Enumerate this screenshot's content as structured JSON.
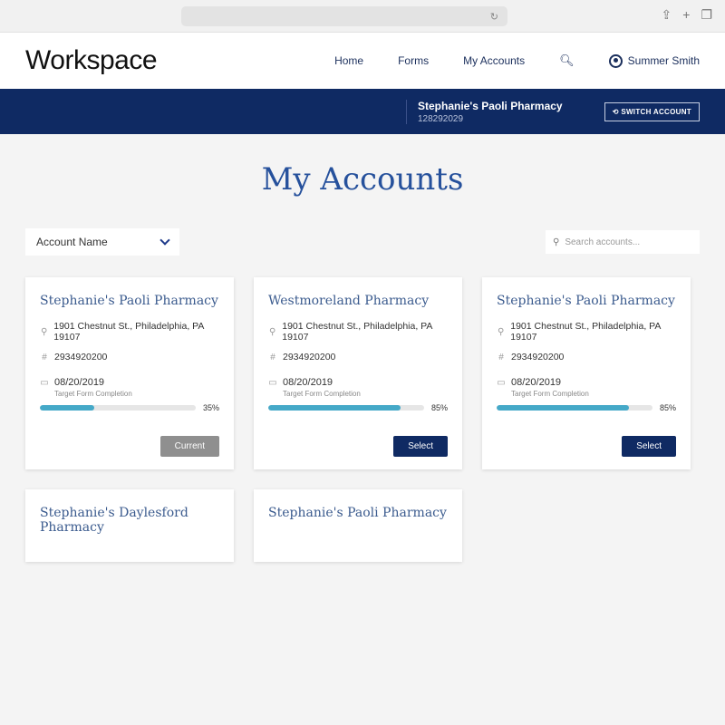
{
  "browser": {
    "url_reload_icon": "reload-icon",
    "actions": [
      "share-icon",
      "new-tab-icon",
      "tabs-icon"
    ]
  },
  "header": {
    "logo": "Workspace",
    "nav": [
      {
        "label": "Home"
      },
      {
        "label": "Forms"
      },
      {
        "label": "My Accounts"
      }
    ],
    "search_icon": "search-icon",
    "user_name": "Summer Smith"
  },
  "account_band": {
    "name": "Stephanie's Paoli Pharmacy",
    "id": "128292029",
    "switch_label": "⟲ SWITCH ACCOUNT"
  },
  "page": {
    "title": "My Accounts",
    "sort_label": "Account Name",
    "search_placeholder": "Search accounts..."
  },
  "cards": [
    {
      "name": "Stephanie's Paoli Pharmacy",
      "address": "1901 Chestnut St., Philadelphia, PA 19107",
      "number": "2934920200",
      "date": "08/20/2019",
      "date_label": "Target Form Completion",
      "progress": 35,
      "progress_label": "35%",
      "button": "Current",
      "button_type": "current"
    },
    {
      "name": "Westmoreland Pharmacy",
      "address": "1901 Chestnut St., Philadelphia, PA 19107",
      "number": "2934920200",
      "date": "08/20/2019",
      "date_label": "Target Form Completion",
      "progress": 85,
      "progress_label": "85%",
      "button": "Select",
      "button_type": "select"
    },
    {
      "name": "Stephanie's Paoli Pharmacy",
      "address": "1901 Chestnut St., Philadelphia, PA 19107",
      "number": "2934920200",
      "date": "08/20/2019",
      "date_label": "Target Form Completion",
      "progress": 85,
      "progress_label": "85%",
      "button": "Select",
      "button_type": "select"
    },
    {
      "name": "Stephanie's Daylesford Pharmacy"
    },
    {
      "name": "Stephanie's Paoli Pharmacy"
    }
  ],
  "colors": {
    "navy": "#0f2a63",
    "title_blue": "#26519c",
    "progress": "#45a9c8",
    "current_button": "#8f8f8f"
  }
}
